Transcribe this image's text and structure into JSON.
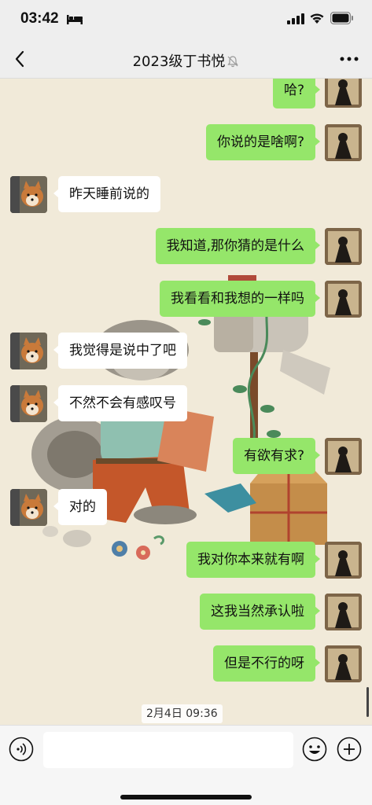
{
  "status_bar": {
    "time": "03:42"
  },
  "nav": {
    "title": "2023级丁书悦"
  },
  "messages": [
    {
      "side": "self",
      "text": "哈?"
    },
    {
      "side": "self",
      "text": "你说的是啥啊?"
    },
    {
      "side": "other",
      "text": "昨天睡前说的"
    },
    {
      "side": "self",
      "text": "我知道,那你猜的是什么"
    },
    {
      "side": "self",
      "text": "我看看和我想的一样吗"
    },
    {
      "side": "other",
      "text": "我觉得是说中了吧"
    },
    {
      "side": "other",
      "text": "不然不会有感叹号"
    },
    {
      "side": "self",
      "text": "有欲有求?"
    },
    {
      "side": "other",
      "text": "对的"
    },
    {
      "side": "self",
      "text": "我对你本来就有啊"
    },
    {
      "side": "self",
      "text": "这我当然承认啦"
    },
    {
      "side": "self",
      "text": "但是不行的呀"
    }
  ],
  "timestamp": "2月4日 09:36",
  "input": {
    "value": ""
  },
  "colors": {
    "self_bubble": "#95e66a",
    "other_bubble": "#ffffff",
    "chat_bg": "#f1ead9"
  }
}
